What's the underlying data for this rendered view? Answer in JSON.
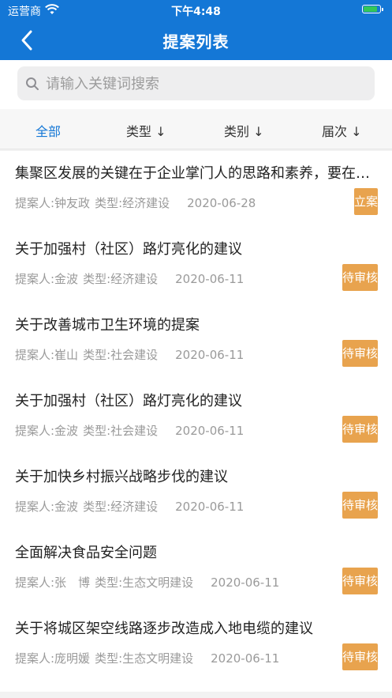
{
  "status_bar": {
    "carrier": "运营商",
    "time": "下午4:48",
    "battery_level": 0.9
  },
  "nav": {
    "title": "提案列表",
    "back_icon": "chevron-left-icon"
  },
  "search": {
    "placeholder": "请输入关键词搜索",
    "value": ""
  },
  "filters": [
    {
      "label": "全部",
      "active": true
    },
    {
      "label": "类型 ↓",
      "active": false
    },
    {
      "label": "类别 ↓",
      "active": false
    },
    {
      "label": "届次 ↓",
      "active": false
    }
  ],
  "proposals": [
    {
      "title": "集聚区发展的关键在于企业掌门人的思路和素养，要在建设和发展中提升",
      "proposer": "提案人:钟友政",
      "type": "类型:经济建设",
      "date": "2020-06-28",
      "status": "立案"
    },
    {
      "title": "关于加强村（社区）路灯亮化的建议",
      "proposer": "提案人:金波",
      "type": "类型:经济建设",
      "date": "2020-06-11",
      "status": "待审核"
    },
    {
      "title": "关于改善城市卫生环境的提案",
      "proposer": "提案人:崔山",
      "type": "类型:社会建设",
      "date": "2020-06-11",
      "status": "待审核"
    },
    {
      "title": "关于加强村（社区）路灯亮化的建议",
      "proposer": "提案人:金波",
      "type": "类型:社会建设",
      "date": "2020-06-11",
      "status": "待审核"
    },
    {
      "title": "关于加快乡村振兴战略步伐的建议",
      "proposer": "提案人:金波",
      "type": "类型:经济建设",
      "date": "2020-06-11",
      "status": "待审核"
    },
    {
      "title": "全面解决食品安全问题",
      "proposer": "提案人:张　博",
      "type": "类型:生态文明建设",
      "date": "2020-06-11",
      "status": "待审核"
    },
    {
      "title": "关于将城区架空线路逐步改造成入地电缆的建议",
      "proposer": "提案人:庞明媛",
      "type": "类型:生态文明建设",
      "date": "2020-06-11",
      "status": "待审核"
    }
  ],
  "colors": {
    "primary": "#1477d6",
    "badge": "#e8a34e",
    "battery": "#34c759"
  }
}
